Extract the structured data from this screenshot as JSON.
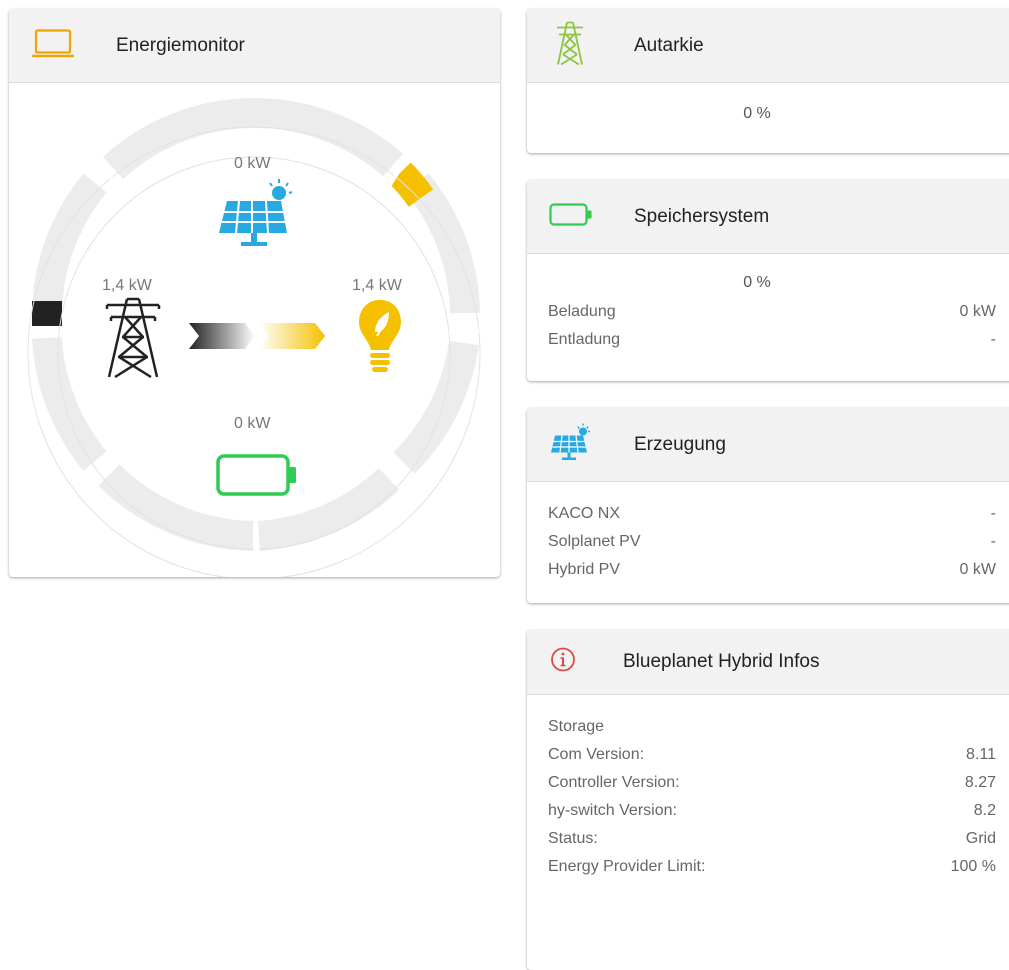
{
  "energy_monitor": {
    "title": "Energiemonitor",
    "solar_power": "0 kW",
    "grid_power": "1,4 kW",
    "consumption_power": "1,4 kW",
    "battery_power": "0 kW",
    "colors": {
      "solar": "#29a9e1",
      "consumer": "#f5c000",
      "grid": "#222222",
      "battery": "#2ecc53",
      "header_icon": "#f0a500"
    }
  },
  "autarkie": {
    "title": "Autarkie",
    "value": "0 %"
  },
  "speicher": {
    "title": "Speichersystem",
    "value": "0 %",
    "rows": [
      {
        "label": "Beladung",
        "value": "0 kW"
      },
      {
        "label": "Entladung",
        "value": "-"
      }
    ]
  },
  "erzeugung": {
    "title": "Erzeugung",
    "rows": [
      {
        "label": "KACO NX",
        "value": "-"
      },
      {
        "label": "Solplanet PV",
        "value": "-"
      },
      {
        "label": "Hybrid PV",
        "value": "0 kW"
      }
    ]
  },
  "blueplanet": {
    "title": "Blueplanet Hybrid Infos",
    "section": "Storage",
    "rows": [
      {
        "label": "Com Version:",
        "value": "8.11"
      },
      {
        "label": "Controller Version:",
        "value": "8.27"
      },
      {
        "label": "hy-switch Version:",
        "value": "8.2"
      },
      {
        "label": "Status:",
        "value": "Grid"
      },
      {
        "label": "Energy Provider Limit:",
        "value": "100 %"
      }
    ]
  },
  "icons": {
    "laptop": "laptop-icon",
    "pylon": "power-pylon-icon",
    "battery": "battery-icon",
    "solar": "solar-panel-icon",
    "bulb": "lightbulb-icon",
    "info": "info-icon"
  }
}
